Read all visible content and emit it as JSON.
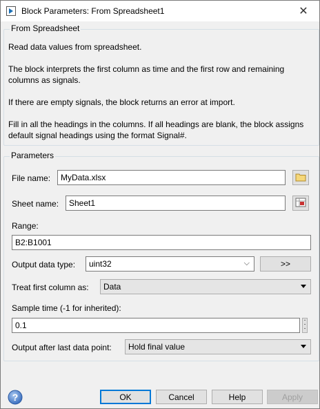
{
  "window": {
    "title": "Block Parameters: From Spreadsheet1",
    "close_symbol": "✕"
  },
  "description_group": {
    "title": "From Spreadsheet",
    "line1": "Read data values from spreadsheet.",
    "line2": "The block interprets the first column as time and the first row and remaining columns as signals.",
    "line3": "If there are empty signals, the block returns an error at import.",
    "line4": "Fill in all the headings in the columns. If all headings are blank, the block assigns default signal headings using the format Signal#."
  },
  "parameters": {
    "title": "Parameters",
    "file_name_label": "File name:",
    "file_name_value": "MyData.xlsx",
    "sheet_name_label": "Sheet name:",
    "sheet_name_value": "Sheet1",
    "range_label": "Range:",
    "range_value": "B2:B1001",
    "output_type_label": "Output data type:",
    "output_type_value": "uint32",
    "output_type_button": ">>",
    "treat_first_label": "Treat first column as:",
    "treat_first_value": "Data",
    "sample_time_label": "Sample time (-1 for inherited):",
    "sample_time_value": "0.1",
    "output_after_label": "Output after last data point:",
    "output_after_value": "Hold final value"
  },
  "footer": {
    "ok": "OK",
    "cancel": "Cancel",
    "help": "Help",
    "apply": "Apply"
  },
  "colors": {
    "ok_border": "#0078d7",
    "group_border": "#d5dfe5",
    "background": "#f0f0f0"
  }
}
